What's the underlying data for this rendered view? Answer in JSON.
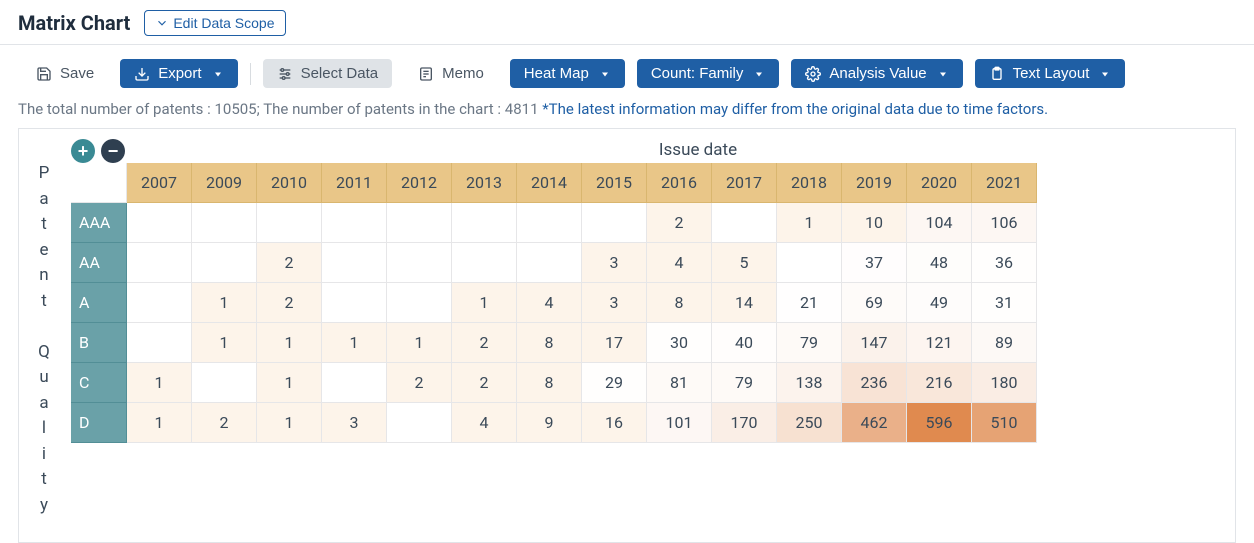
{
  "header": {
    "title": "Matrix Chart",
    "edit_scope": "Edit Data Scope"
  },
  "toolbar": {
    "save": "Save",
    "export": "Export",
    "select_data": "Select Data",
    "memo": "Memo",
    "heat_map": "Heat Map",
    "count_family": "Count: Family",
    "analysis_value": "Analysis Value",
    "text_layout": "Text Layout"
  },
  "info": {
    "text_a": "The total number of patents : 10505; The number of patents in the chart : 4811 ",
    "note": "*The latest information may differ from the original data due to time factors."
  },
  "axes": {
    "x_title": "Issue date",
    "y_title": "Patent Quality"
  },
  "chart_data": {
    "type": "heatmap",
    "title": "Matrix Chart",
    "xlabel": "Issue date",
    "ylabel": "Patent Quality",
    "x_categories": [
      "2007",
      "2009",
      "2010",
      "2011",
      "2012",
      "2013",
      "2014",
      "2015",
      "2016",
      "2017",
      "2018",
      "2019",
      "2020",
      "2021"
    ],
    "y_categories": [
      "AAA",
      "AA",
      "A",
      "B",
      "C",
      "D"
    ],
    "values": [
      [
        null,
        null,
        null,
        null,
        null,
        null,
        null,
        null,
        2,
        null,
        1,
        10,
        104,
        106
      ],
      [
        null,
        null,
        2,
        null,
        null,
        null,
        null,
        3,
        4,
        5,
        null,
        37,
        48,
        36
      ],
      [
        null,
        1,
        2,
        null,
        null,
        1,
        4,
        3,
        8,
        14,
        21,
        69,
        49,
        31
      ],
      [
        null,
        1,
        1,
        1,
        1,
        2,
        8,
        17,
        30,
        40,
        79,
        147,
        121,
        89
      ],
      [
        1,
        null,
        1,
        null,
        2,
        2,
        8,
        29,
        81,
        79,
        138,
        236,
        216,
        180
      ],
      [
        1,
        2,
        1,
        3,
        null,
        4,
        9,
        16,
        101,
        170,
        250,
        462,
        596,
        510
      ]
    ],
    "legend": "Count: Family",
    "color_scale": {
      "min_color": "#ffffff",
      "max_color": "#e08a4f",
      "max_value": 596
    }
  }
}
